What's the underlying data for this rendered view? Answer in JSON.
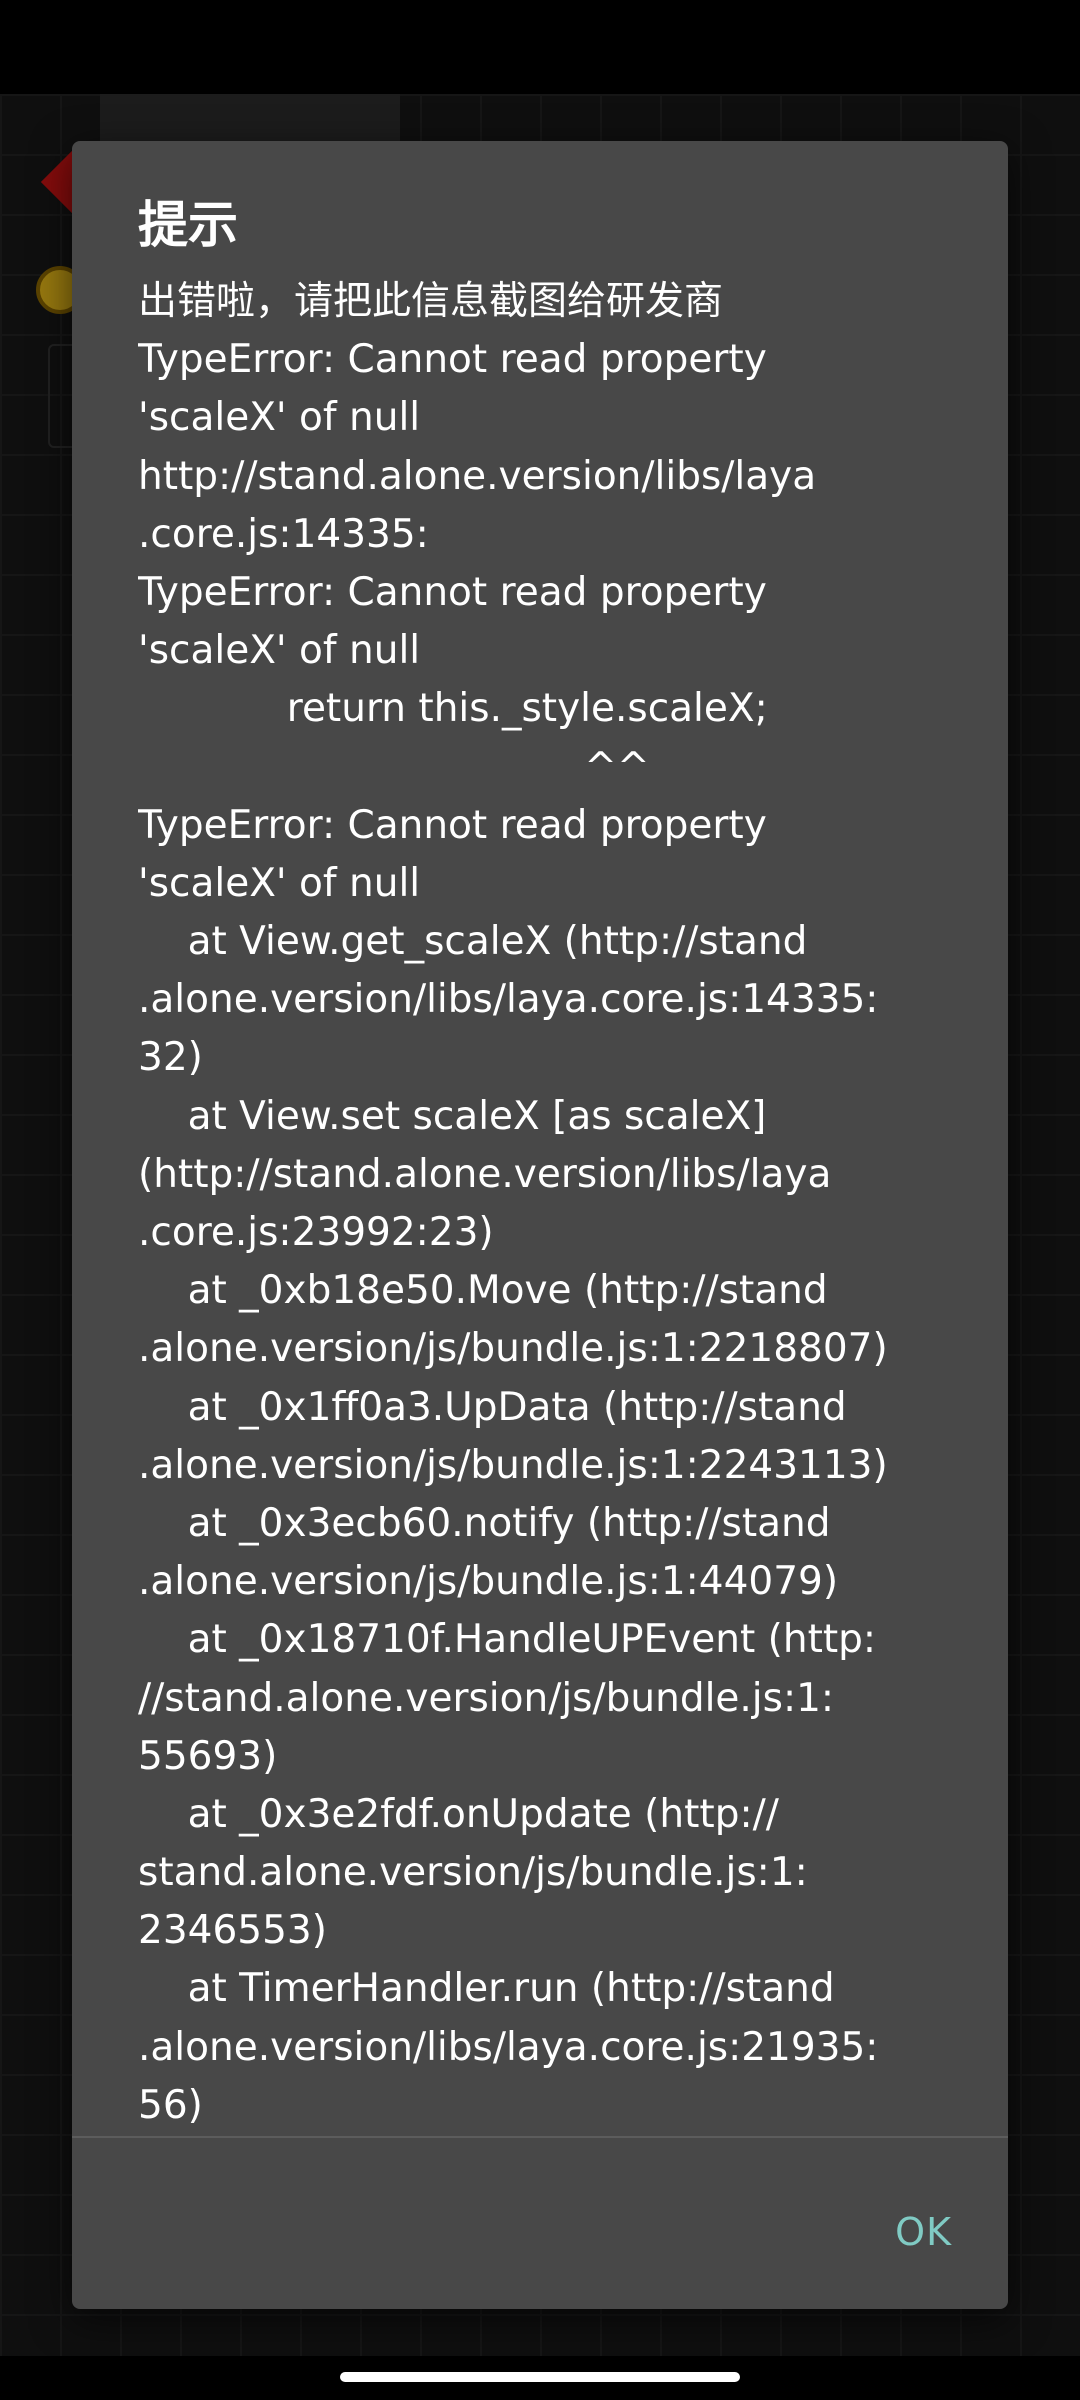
{
  "dialog": {
    "title": "提示",
    "lines": [
      "出错啦，请把此信息截图给研发商",
      "TypeError: Cannot read property",
      "'scaleX' of null",
      "http://stand.alone.version/libs/laya",
      ".core.js:14335:",
      "TypeError: Cannot read property",
      "'scaleX' of null",
      "            return this._style.scaleX;",
      "                                    ^^",
      "TypeError: Cannot read property",
      "'scaleX' of null",
      "    at View.get_scaleX (http://stand",
      ".alone.version/libs/laya.core.js:14335:",
      "32)",
      "    at View.set scaleX [as scaleX]",
      "(http://stand.alone.version/libs/laya",
      ".core.js:23992:23)",
      "    at _0xb18e50.Move (http://stand",
      ".alone.version/js/bundle.js:1:2218807)",
      "    at _0x1ff0a3.UpData (http://stand",
      ".alone.version/js/bundle.js:1:2243113)",
      "    at _0x3ecb60.notify (http://stand",
      ".alone.version/js/bundle.js:1:44079)",
      "    at _0x18710f.HandleUPEvent (http:",
      "//stand.alone.version/js/bundle.js:1:",
      "55693)",
      "    at _0x3e2fdf.onUpdate (http://",
      "stand.alone.version/js/bundle.js:1:",
      "2346553)",
      "    at TimerHandler.run (http://stand",
      ".alone.version/libs/laya.core.js:21935:",
      "56)"
    ],
    "ok_label": "OK"
  },
  "colors": {
    "dialog_background": "#484848",
    "accent": "#80cbc4",
    "text": "#ffffff"
  }
}
